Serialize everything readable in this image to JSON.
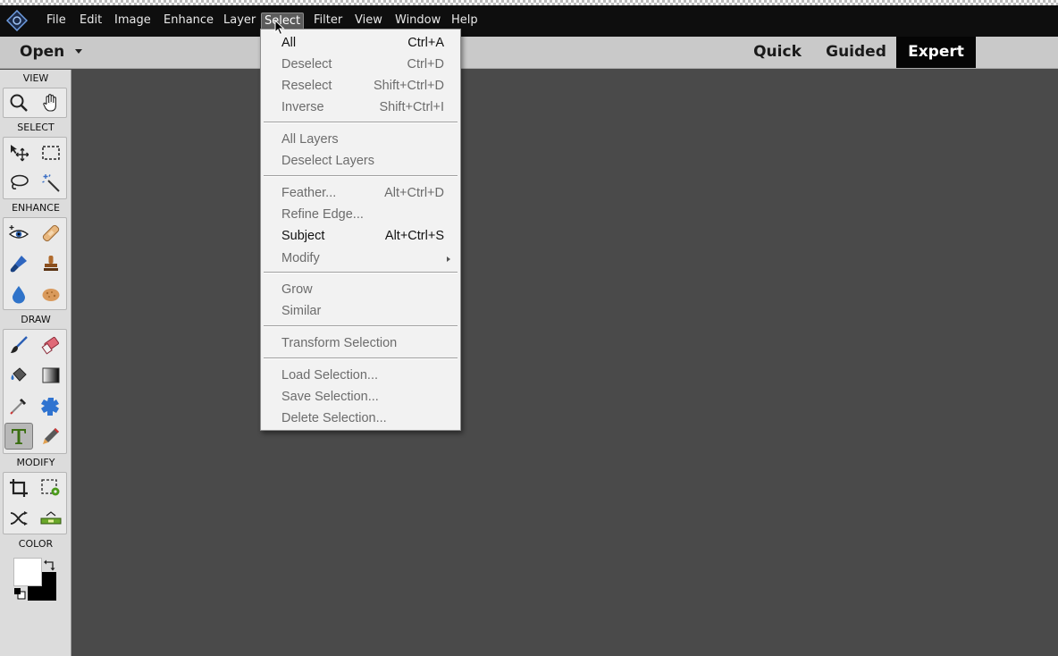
{
  "menubar": {
    "items": [
      {
        "label": "File"
      },
      {
        "label": "Edit"
      },
      {
        "label": "Image"
      },
      {
        "label": "Enhance"
      },
      {
        "label": "Layer"
      },
      {
        "label": "Select",
        "active": true
      },
      {
        "label": "Filter"
      },
      {
        "label": "View"
      },
      {
        "label": "Window"
      },
      {
        "label": "Help"
      }
    ]
  },
  "modebar": {
    "open_label": "Open",
    "tabs": [
      {
        "label": "Quick"
      },
      {
        "label": "Guided"
      },
      {
        "label": "Expert",
        "selected": true
      }
    ]
  },
  "toolbar": {
    "sections": {
      "view": "VIEW",
      "select": "SELECT",
      "enhance": "ENHANCE",
      "draw": "DRAW",
      "modify": "MODIFY",
      "color": "COLOR"
    },
    "selected_tool": "horizontal-type-tool",
    "foreground_color": "#ffffff",
    "background_color": "#000000"
  },
  "select_menu": {
    "items": [
      {
        "label": "All",
        "shortcut": "Ctrl+A",
        "enabled": true
      },
      {
        "label": "Deselect",
        "shortcut": "Ctrl+D",
        "enabled": false
      },
      {
        "label": "Reselect",
        "shortcut": "Shift+Ctrl+D",
        "enabled": false
      },
      {
        "label": "Inverse",
        "shortcut": "Shift+Ctrl+I",
        "enabled": false
      },
      {
        "label": "All Layers",
        "shortcut": "",
        "enabled": false
      },
      {
        "label": "Deselect Layers",
        "shortcut": "",
        "enabled": false
      },
      {
        "label": "Feather...",
        "shortcut": "Alt+Ctrl+D",
        "enabled": false
      },
      {
        "label": "Refine Edge...",
        "shortcut": "",
        "enabled": false
      },
      {
        "label": "Subject",
        "shortcut": "Alt+Ctrl+S",
        "enabled": true
      },
      {
        "label": "Modify",
        "shortcut": "",
        "enabled": false,
        "submenu": true
      },
      {
        "label": "Grow",
        "shortcut": "",
        "enabled": false
      },
      {
        "label": "Similar",
        "shortcut": "",
        "enabled": false
      },
      {
        "label": "Transform Selection",
        "shortcut": "",
        "enabled": false
      },
      {
        "label": "Load Selection...",
        "shortcut": "",
        "enabled": false
      },
      {
        "label": "Save Selection...",
        "shortcut": "",
        "enabled": false
      },
      {
        "label": "Delete Selection...",
        "shortcut": "",
        "enabled": false
      }
    ]
  },
  "colors": {
    "menubar_bg": "#0e0e0e",
    "canvas_bg": "#4a4a4a",
    "toolbar_bg": "#dcdcdc",
    "expert_tab_bg": "#050505"
  }
}
